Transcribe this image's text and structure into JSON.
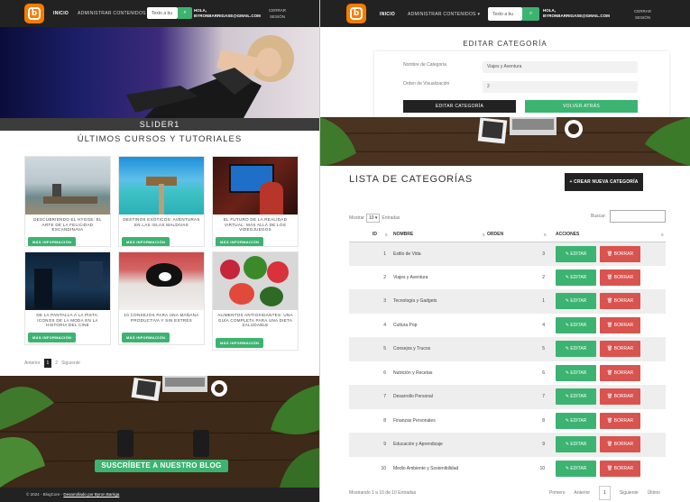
{
  "left": {
    "nav": {
      "inicio": "INICIO",
      "admin": "ADMINISTRAR CONTENIDOS",
      "search_placeholder": "Texto a bu",
      "user_line1": "HOLA,",
      "user_line2": "BYRONBARRIGASE@GMAIL.COM",
      "logout_line1": "CERRAR",
      "logout_line2": "SESIÓN"
    },
    "slider_label": "SLIDER1",
    "section_title": "ÚLTIMOS CURSOS Y TUTORIALES",
    "more_label": "MÁS INFORMACIÓN",
    "cards": [
      {
        "title": "DESCUBRIENDO EL HYGGE: EL ARTE DE LA FELICIDAD ESCANDINAVA"
      },
      {
        "title": "DESTINOS EXÓTICOS: AVENTURAS EN LAS ISLAS MALDIVAS"
      },
      {
        "title": "EL FUTURO DE LA REALIDAD VIRTUAL: MÁS ALLÁ DE LOS VIDEOJUEGOS"
      },
      {
        "title": "DE LA PANTALLA A LA PISTA: ICONOS DE LA MODA EN LA HISTORIA DEL CINE"
      },
      {
        "title": "10 CONSEJOS PARA UNA MAÑANA PRODUCTIVA Y SIN ESTRÉS"
      },
      {
        "title": "ALIMENTOS ANTIOXIDANTES: UNA GUÍA COMPLETA PARA UNA DIETA SALUDABLE"
      }
    ],
    "pager": {
      "prev": "Anterior",
      "p1": "1",
      "p2": "2",
      "next": "Siguiente"
    },
    "subscribe": "SUSCRÍBETE A NUESTRO BLOG",
    "footer_text": "© 2024 - BlogCore - ",
    "footer_link": "Desarrollado por Byron Barriga"
  },
  "right": {
    "nav": {
      "inicio": "INICIO",
      "admin": "ADMINISTRAR CONTENIDOS",
      "search_placeholder": "Texto a bu",
      "user_line1": "HOLA,",
      "user_line2": "BYRONBARRIGASE@GMAIL.COM",
      "logout_line1": "CERRAR",
      "logout_line2": "SESIÓN"
    },
    "form": {
      "title": "EDITAR CATEGORÍA",
      "name_label": "Nombre de Categoría",
      "name_value": "Viajes y Aventura",
      "order_label": "Orden de Visualización",
      "order_value": "2",
      "edit_btn": "EDITAR CATEGORÍA",
      "back_btn": "VOLVER ATRÁS"
    },
    "list": {
      "title": "LISTA DE CATEGORÍAS",
      "new_btn": "+ CREAR NUEVA CATEGORÍA",
      "show_label": "Mostrar",
      "show_value": "10",
      "entries_label": "Entradas",
      "search_label": "Buscar:",
      "headers": {
        "id": "ID",
        "name": "NOMBRE",
        "order": "ORDEN",
        "actions": "ACCIONES"
      },
      "edit_label": "EDITAR",
      "delete_label": "BORRAR",
      "rows": [
        {
          "id": "1",
          "name": "Estilo de Vida",
          "order": "3"
        },
        {
          "id": "2",
          "name": "Viajes y Aventura",
          "order": "2"
        },
        {
          "id": "3",
          "name": "Tecnología y Gadgets",
          "order": "1"
        },
        {
          "id": "4",
          "name": "Cultura Pop",
          "order": "4"
        },
        {
          "id": "5",
          "name": "Consejos y Trucos",
          "order": "5"
        },
        {
          "id": "6",
          "name": "Nutrición y Recetas",
          "order": "6"
        },
        {
          "id": "7",
          "name": "Desarrollo Personal",
          "order": "7"
        },
        {
          "id": "8",
          "name": "Finanzas Personales",
          "order": "8"
        },
        {
          "id": "9",
          "name": "Educación y Aprendizaje",
          "order": "9"
        },
        {
          "id": "10",
          "name": "Medio Ambiente y Sostenibilidad",
          "order": "10"
        }
      ],
      "info": "Mostrando 1 a 10 de 10 Entradas",
      "pager": {
        "first": "Primero",
        "prev": "Anterior",
        "cur": "1",
        "next": "Siguiente",
        "last": "Último"
      }
    }
  },
  "colors": {
    "brand_orange": "#f57c00",
    "accent_green": "#3cb371",
    "danger_red": "#d9534f",
    "nav_dark": "#222222"
  }
}
